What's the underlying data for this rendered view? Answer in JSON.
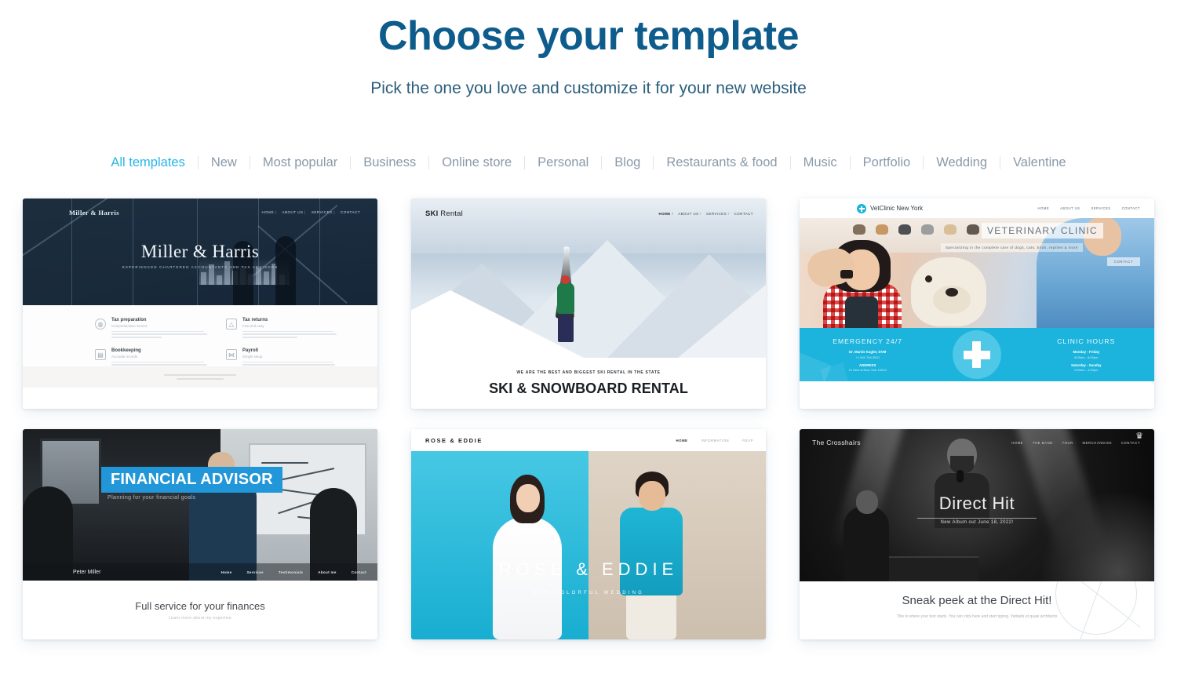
{
  "header": {
    "title": "Choose your template",
    "subtitle": "Pick the one you love and customize it for your new website",
    "title_color": "#0d5c8c"
  },
  "filters": {
    "active_color": "#29b6e8",
    "items": [
      {
        "label": "All templates",
        "active": true
      },
      {
        "label": "New",
        "active": false
      },
      {
        "label": "Most popular",
        "active": false
      },
      {
        "label": "Business",
        "active": false
      },
      {
        "label": "Online store",
        "active": false
      },
      {
        "label": "Personal",
        "active": false
      },
      {
        "label": "Blog",
        "active": false
      },
      {
        "label": "Restaurants & food",
        "active": false
      },
      {
        "label": "Music",
        "active": false
      },
      {
        "label": "Portfolio",
        "active": false
      },
      {
        "label": "Wedding",
        "active": false
      },
      {
        "label": "Valentine",
        "active": false
      }
    ]
  },
  "templates": [
    {
      "id": "miller-harris",
      "logo": "Miller & Harris",
      "nav": [
        "HOME",
        "ABOUT US",
        "SERVICES",
        "CONTACT"
      ],
      "hero_title": "Miller & Harris",
      "hero_sub": "EXPERIENCED CHARTERED ACCOUNTANTS AND TAX ADVISORS",
      "services": [
        {
          "title": "Tax preparation",
          "sub": "Comprehensive service"
        },
        {
          "title": "Tax returns",
          "sub": "Fast and easy"
        },
        {
          "title": "Bookkeeping",
          "sub": "Accurate records"
        },
        {
          "title": "Payroll",
          "sub": "Simple setup"
        }
      ]
    },
    {
      "id": "ski-rental",
      "logo_bold": "SKI",
      "logo_rest": " Rental",
      "nav": [
        "HOME",
        "ABOUT US",
        "SERVICES",
        "CONTACT"
      ],
      "caption_small": "WE ARE THE BEST AND BIGGEST SKI RENTAL IN THE STATE",
      "caption_large": "SKI & SNOWBOARD RENTAL"
    },
    {
      "id": "vet-clinic",
      "brand": "VetClinic New York",
      "nav": [
        "HOME",
        "ABOUT US",
        "SERVICES",
        "CONTACT"
      ],
      "overlay_title": "VETERINARY CLINIC",
      "overlay_sub": "Specializing in the complete care of dogs, cats, birds, reptiles & more",
      "overlay_button": "CONTACT",
      "band": {
        "left_title": "EMERGENCY 24/7",
        "left_line1": "Dr. Martin Kugler, DVM",
        "left_line2": "+1 541 754 3010",
        "left_line3": "ADDRESS",
        "left_line4": "21 New st New York 10012",
        "right_title": "CLINIC HOURS",
        "right_line1": "Monday - Friday",
        "right_line2": "8:00am - 8:00pm",
        "right_line3": "Saturday - Sunday",
        "right_line4": "9:00am - 4:00pm"
      },
      "accent_color": "#1cb4dd"
    },
    {
      "id": "financial-advisor",
      "badge": "FINANCIAL ADVISOR",
      "badge_sub": "Planning for your financial goals",
      "badge_color": "#2196d8",
      "brand": "Peter Miller",
      "nav": [
        "Home",
        "Services",
        "Testimonials",
        "About me",
        "Contact"
      ],
      "heading": "Full service for your finances",
      "sub": "Learn more about my expertise"
    },
    {
      "id": "rose-eddie",
      "brand": "ROSE & EDDIE",
      "nav": [
        "HOME",
        "INFORMATION",
        "RSVP"
      ],
      "overlay_title": "ROSE & EDDIE",
      "overlay_sub": "OUR COLORFUL WEDDING"
    },
    {
      "id": "the-crosshairs",
      "brand": "The Crosshairs",
      "nav": [
        "HOME",
        "THE BAND",
        "TOUR",
        "MERCHANDISE",
        "CONTACT"
      ],
      "hero_title": "Direct Hit",
      "hero_sub": "New Album out June 18, 2022!",
      "heading": "Sneak peek at the Direct Hit!",
      "body": "This is where your text starts. You can click here and start typing. Veritatis et quasi architecto"
    }
  ]
}
